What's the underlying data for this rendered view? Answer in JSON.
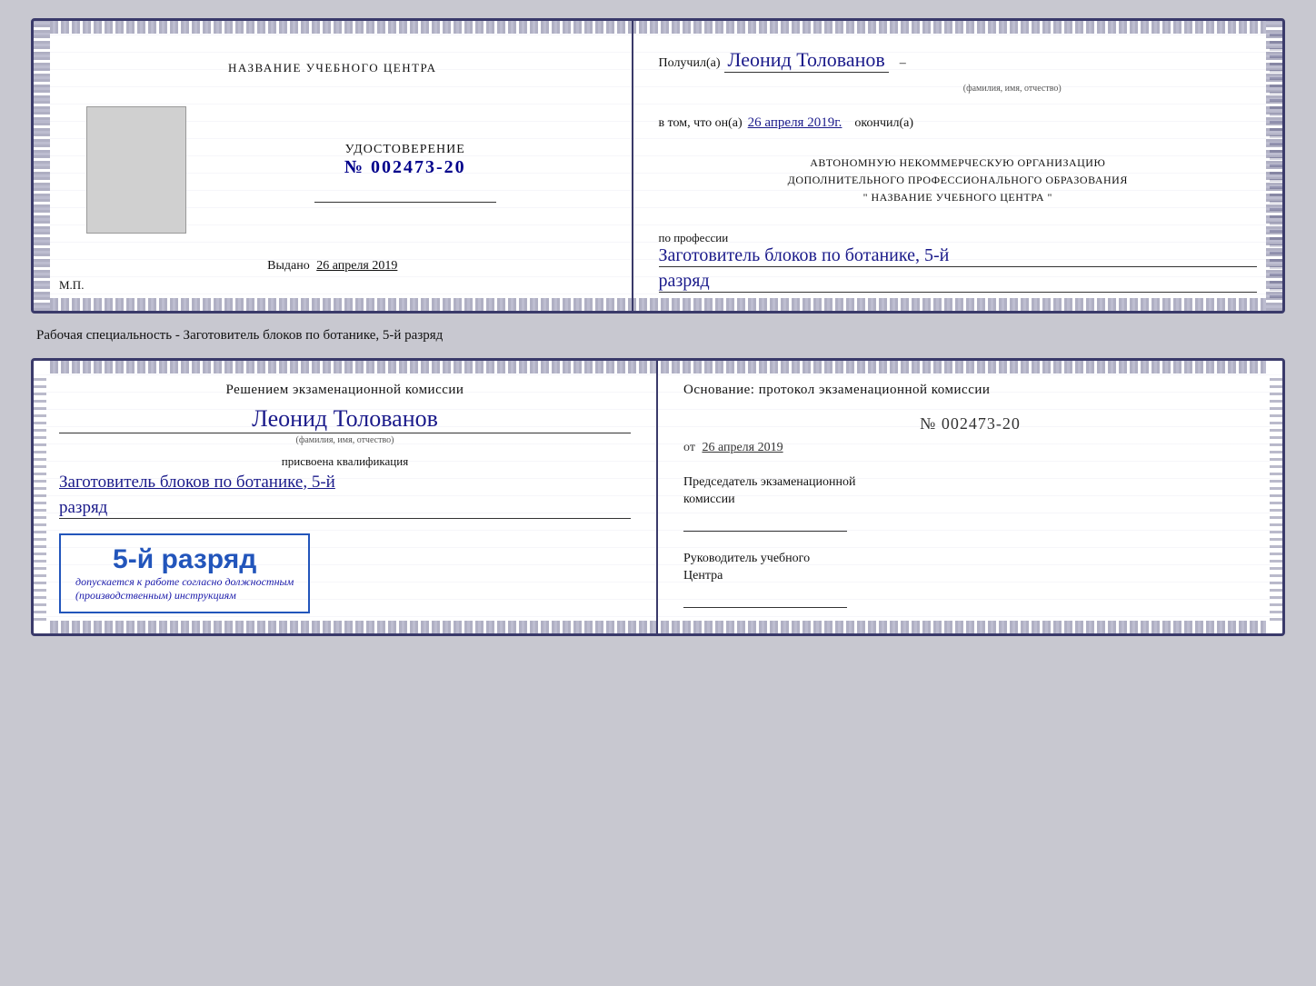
{
  "top_doc": {
    "left": {
      "center_title": "НАЗВАНИЕ УЧЕБНОГО ЦЕНТРА",
      "cert_label": "УДОСТОВЕРЕНИЕ",
      "cert_number": "№ 002473-20",
      "issued_label": "Выдано",
      "issued_date": "26 апреля 2019",
      "mp_label": "М.П."
    },
    "right": {
      "recipient_prefix": "Получил(а)",
      "recipient_name": "Леонид Толованов",
      "recipient_caption": "(фамилия, имя, отчество)",
      "date_prefix": "в том, что он(а)",
      "date_value": "26 апреля 2019г.",
      "date_suffix": "окончил(а)",
      "org_line1": "АВТОНОМНУЮ НЕКОММЕРЧЕСКУЮ ОРГАНИЗАЦИЮ",
      "org_line2": "ДОПОЛНИТЕЛЬНОГО ПРОФЕССИОНАЛЬНОГО ОБРАЗОВАНИЯ",
      "org_line3": "\" НАЗВАНИЕ УЧЕБНОГО ЦЕНТРА \"",
      "profession_label": "по профессии",
      "profession_value": "Заготовитель блоков по ботанике, 5-й",
      "razryad_value": "разряд"
    }
  },
  "specialty_label": "Рабочая специальность - Заготовитель блоков по ботанике, 5-й разряд",
  "bottom_doc": {
    "left": {
      "commission_title": "Решением экзаменационной комиссии",
      "person_name": "Леонид Толованов",
      "name_caption": "(фамилия, имя, отчество)",
      "qualification_label": "присвоена квалификация",
      "qualification_value": "Заготовитель блоков по ботанике, 5-й",
      "razryad_value": "разряд",
      "stamp_grade": "5-й разряд",
      "stamp_note1": "допускается к работе согласно должностным",
      "stamp_note2": "(производственным) инструкциям"
    },
    "right": {
      "basis_label": "Основание: протокол экзаменационной комиссии",
      "protocol_number": "№ 002473-20",
      "date_prefix": "от",
      "date_value": "26 апреля 2019",
      "chairman_title1": "Председатель экзаменационной",
      "chairman_title2": "комиссии",
      "director_title1": "Руководитель учебного",
      "director_title2": "Центра"
    }
  }
}
